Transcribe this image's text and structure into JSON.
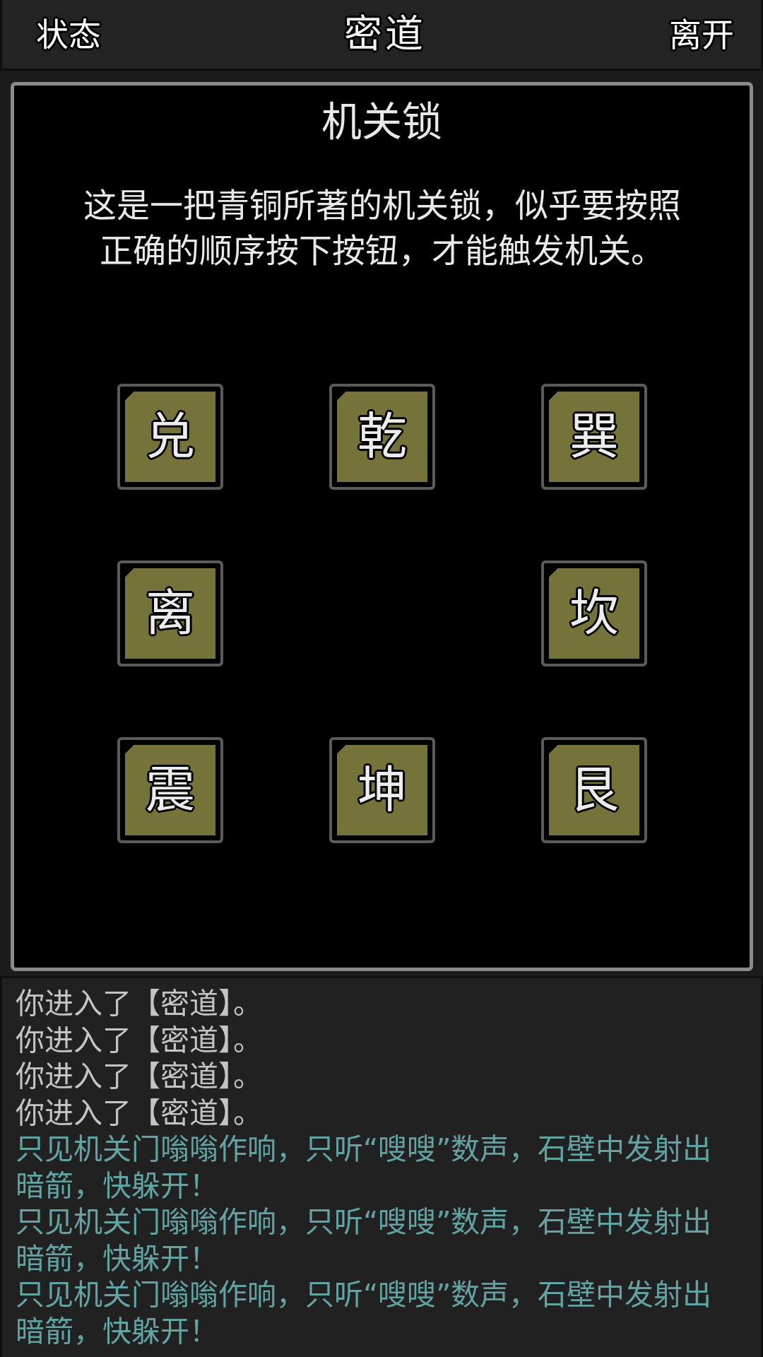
{
  "top_bar": {
    "left_button": "状态",
    "title": "密道",
    "right_button": "离开"
  },
  "dialog": {
    "title": "机关锁",
    "description": "这是一把青铜所著的机关锁，似乎要按照正确的顺序按下按钮，才能触发机关。",
    "buttons": [
      "兑",
      "乾",
      "巽",
      "离",
      "坎",
      "震",
      "坤",
      "艮"
    ]
  },
  "log": [
    {
      "kind": "info",
      "text": "你进入了【密道】。"
    },
    {
      "kind": "info",
      "text": "你进入了【密道】。"
    },
    {
      "kind": "info",
      "text": "你进入了【密道】。"
    },
    {
      "kind": "info",
      "text": "你进入了【密道】。"
    },
    {
      "kind": "event",
      "text": "只见机关门嗡嗡作响，只听“嗖嗖”数声，石壁中发射出暗箭，快躲开！"
    },
    {
      "kind": "event",
      "text": "只见机关门嗡嗡作响，只听“嗖嗖”数声，石壁中发射出暗箭，快躲开！"
    },
    {
      "kind": "event",
      "text": "只见机关门嗡嗡作响，只听“嗖嗖”数声，石壁中发射出暗箭，快躲开！"
    }
  ]
}
